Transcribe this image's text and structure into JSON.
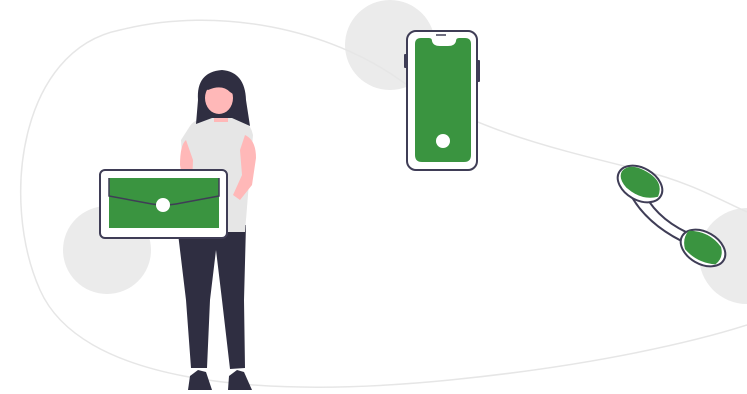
{
  "colors": {
    "background": "#ffffff",
    "accent_green": "#3a9440",
    "skin": "#ffb8b8",
    "hair": "#2f2e41",
    "shirt": "#e6e6e6",
    "pants": "#2f2e41",
    "outline": "#3f3d56",
    "blob": "#ebebeb",
    "curve": "#e6e6e6"
  },
  "scene": {
    "figures": [
      {
        "name": "woman-figure",
        "icon": "person-holding-envelope"
      },
      {
        "name": "envelope-icon",
        "icon": "envelope"
      },
      {
        "name": "smartphone-icon",
        "icon": "smartphone"
      },
      {
        "name": "phone-handset-icon",
        "icon": "telephone-handset"
      }
    ]
  }
}
